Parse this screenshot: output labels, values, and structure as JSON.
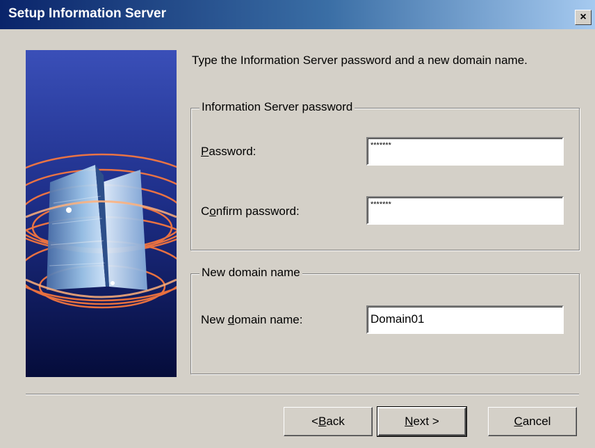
{
  "window": {
    "title": "Setup Information Server",
    "close_glyph": "×"
  },
  "intro": {
    "text": "Type the Information Server password and a new domain name."
  },
  "password_group": {
    "title": "Information Server password",
    "password_label": {
      "ul": "P",
      "rest": "assword:"
    },
    "password_value": "*******",
    "confirm_label": {
      "pre": "C",
      "ul": "o",
      "rest": "nfirm password:"
    },
    "confirm_value": "*******"
  },
  "domain_group": {
    "title": "New domain name",
    "domain_label": {
      "pre": "New ",
      "ul": "d",
      "rest": "omain name:"
    },
    "domain_value": "Domain01"
  },
  "buttons": {
    "back": {
      "pre": "< ",
      "ul": "B",
      "rest": "ack"
    },
    "next": {
      "ul": "N",
      "rest": "ext >"
    },
    "cancel": {
      "ul": "C",
      "rest": "ancel"
    }
  },
  "colors": {
    "title_start": "#0a246a",
    "title_end": "#a6caf0",
    "dialog_bg": "#d4d0c8"
  },
  "icons": {
    "close": "close-icon",
    "banner": "server-buildings-illustration"
  }
}
